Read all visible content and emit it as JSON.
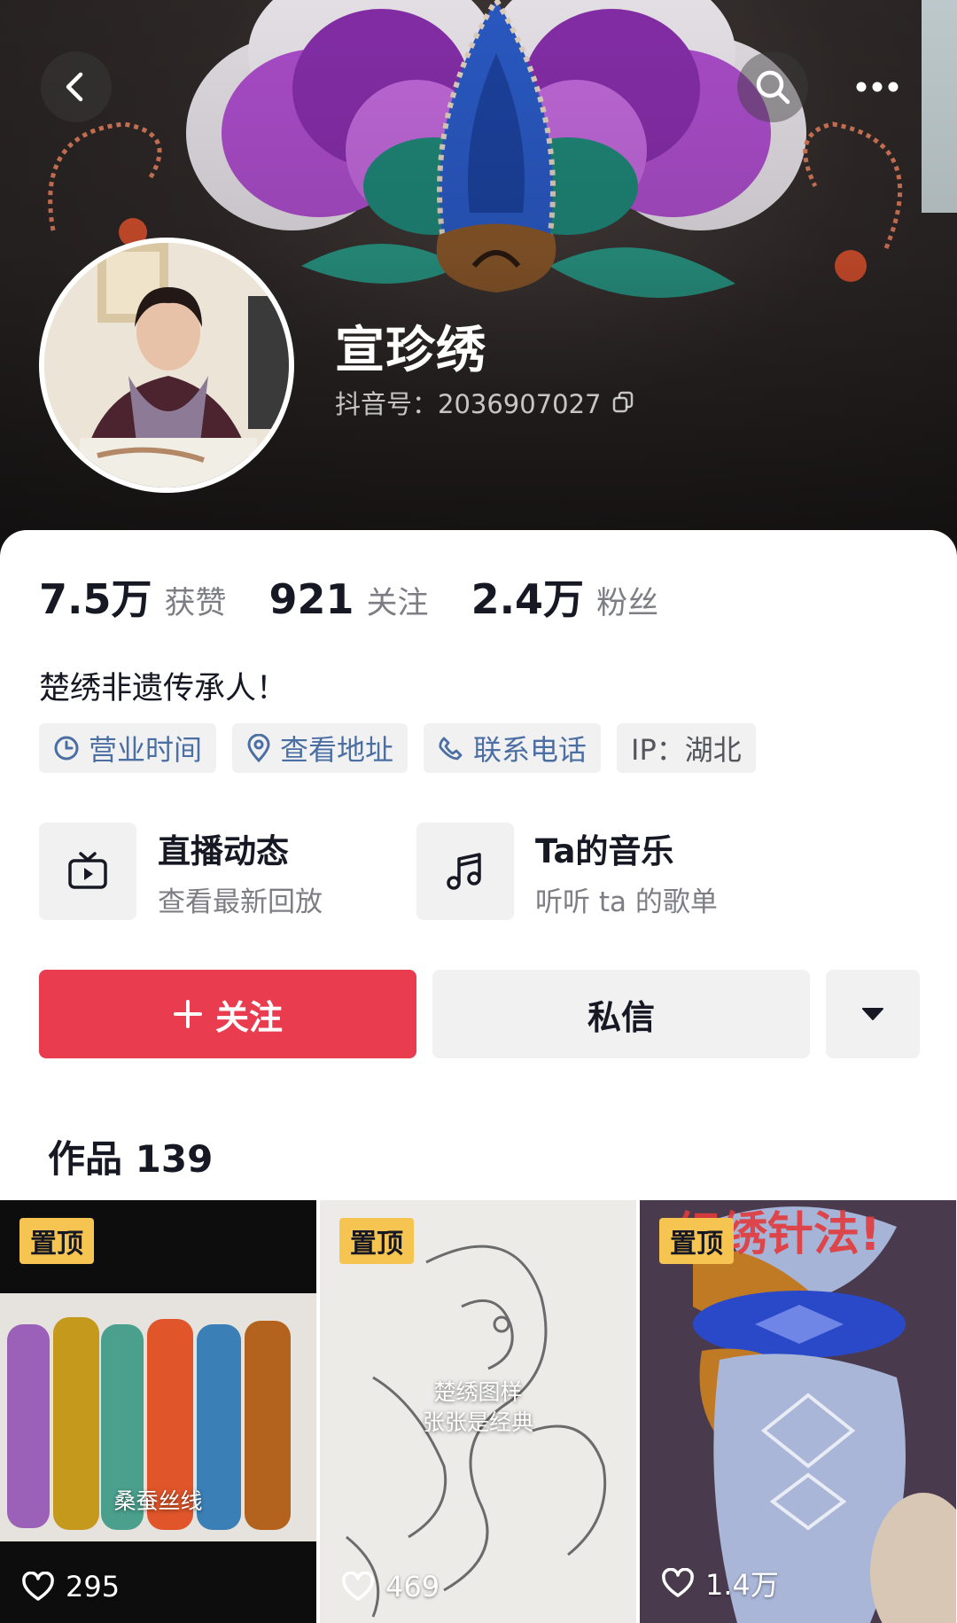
{
  "profile": {
    "name": "宣珍绣",
    "douyin_id": "抖音号：2036907027",
    "bio": "楚绣非遗传承人！"
  },
  "stats": [
    {
      "value": "7.5万",
      "label": "获赞"
    },
    {
      "value": "921",
      "label": "关注"
    },
    {
      "value": "2.4万",
      "label": "粉丝"
    }
  ],
  "tags": [
    {
      "label": "营业时间",
      "icon": "clock-icon"
    },
    {
      "label": "查看地址",
      "icon": "location-pin-icon"
    },
    {
      "label": "联系电话",
      "icon": "phone-icon"
    },
    {
      "label": "IP：湖北"
    }
  ],
  "features": [
    {
      "title": "直播动态",
      "subtitle": "查看最新回放",
      "icon": "tv-icon"
    },
    {
      "title": "Ta的音乐",
      "subtitle": "听听 ta 的歌单",
      "icon": "music-note-icon"
    }
  ],
  "actions": {
    "follow_label": "关注",
    "message_label": "私信"
  },
  "works": {
    "title": "作品 139",
    "items": [
      {
        "pin": "置顶",
        "likes": "295",
        "caption": "桑蚕丝线"
      },
      {
        "pin": "置顶",
        "likes": "469",
        "caption_line1": "楚绣图样",
        "caption_line2": "张张是经典"
      },
      {
        "pin": "置顶",
        "likes": "1.4万",
        "caption": "织绣针法!"
      }
    ]
  },
  "colors": {
    "accent_red": "#ea3c4f",
    "link_blue": "#4c6fa3",
    "pin_yellow": "#f5c451"
  }
}
